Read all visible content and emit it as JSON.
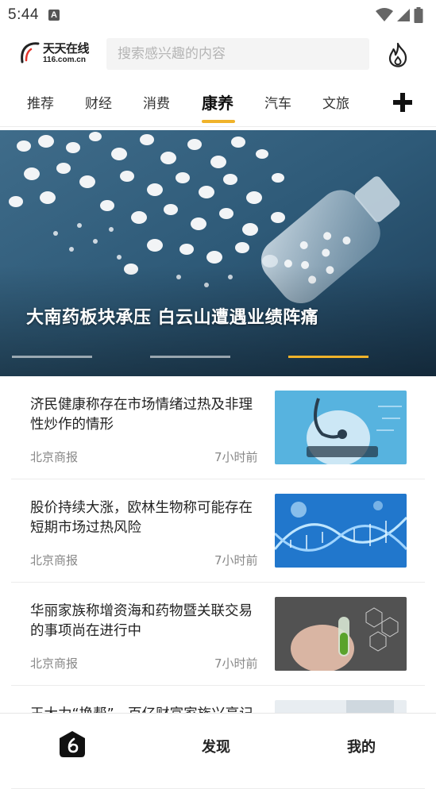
{
  "status_bar": {
    "time": "5:44",
    "notification_icon": "A"
  },
  "header": {
    "logo": {
      "name": "天天在线",
      "domain": "116.com.cn"
    },
    "search": {
      "placeholder": "搜索感兴趣的内容"
    },
    "hot_icon": "flame-icon"
  },
  "tabs": {
    "items": [
      {
        "label": "推荐"
      },
      {
        "label": "财经"
      },
      {
        "label": "消费"
      },
      {
        "label": "康养",
        "active": true
      },
      {
        "label": "汽车"
      },
      {
        "label": "文旅"
      }
    ],
    "add_icon": "plus-icon"
  },
  "banner": {
    "title": "大南药板块承压 白云山遭遇业绩阵痛",
    "slide_count": 3,
    "active_slide": 3
  },
  "news": [
    {
      "title": "济民健康称存在市场情绪过热及非理性炒作的情形",
      "source": "北京商报",
      "time": "7小时前"
    },
    {
      "title": "股价持续大涨，欧林生物称可能存在短期市场过热风险",
      "source": "北京商报",
      "time": "7小时前"
    },
    {
      "title": "华丽家族称增资海和药物暨关联交易的事项尚在进行中",
      "source": "北京商报",
      "time": "7小时前"
    },
    {
      "title": "王大力“换帮”，百亿财富家族兴亭记",
      "source": "",
      "time": ""
    }
  ],
  "bottom_nav": {
    "home_icon": "home-logo-icon",
    "discover": "发现",
    "mine": "我的"
  },
  "colors": {
    "accent": "#f0b32a",
    "text": "#222222",
    "muted": "#888888"
  }
}
